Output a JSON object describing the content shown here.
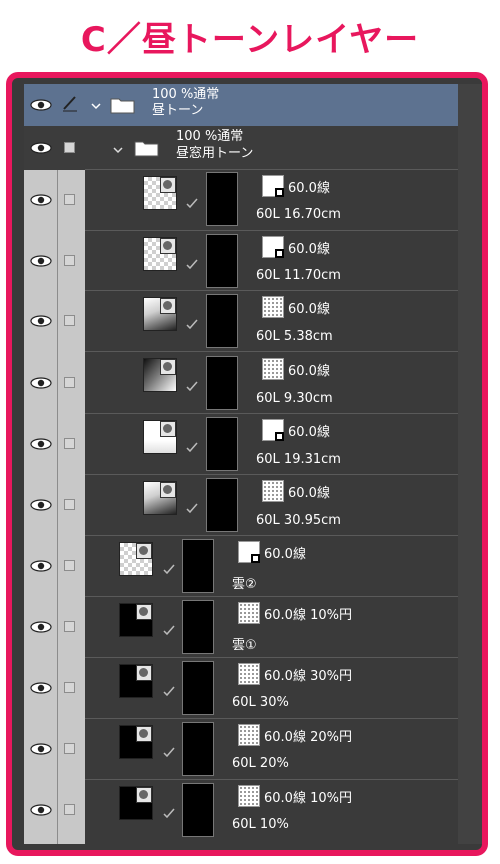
{
  "page_title": "C／昼トーンレイヤー",
  "colors": {
    "accent": "#e8175d",
    "panel_bg": "#3a3a3a",
    "selected_row": "#5d7290",
    "left_column": "#c8c8c8"
  },
  "folders": [
    {
      "line1": "100 %通常",
      "line2": "昼トーン",
      "selected": true
    },
    {
      "line1": "100 %通常",
      "line2": "昼窓用トーン",
      "selected": false
    }
  ],
  "layers": [
    {
      "tone": "60.0線",
      "name": "60L 16.70cm"
    },
    {
      "tone": "60.0線",
      "name": "60L 11.70cm"
    },
    {
      "tone": "60.0線",
      "name": "60L 5.38cm"
    },
    {
      "tone": "60.0線",
      "name": "60L 9.30cm"
    },
    {
      "tone": "60.0線",
      "name": "60L 19.31cm"
    },
    {
      "tone": "60.0線",
      "name": "60L 30.95cm"
    },
    {
      "tone": "60.0線",
      "name": "雲②"
    },
    {
      "tone": "60.0線 10%円",
      "name": "雲①"
    },
    {
      "tone": "60.0線 30%円",
      "name": "60L 30%"
    },
    {
      "tone": "60.0線 20%円",
      "name": "60L 20%"
    },
    {
      "tone": "60.0線 10%円",
      "name": "60L 10%"
    }
  ]
}
